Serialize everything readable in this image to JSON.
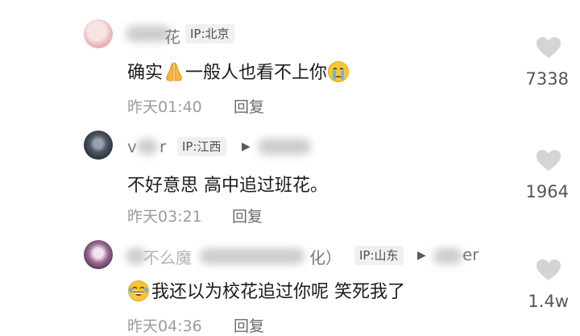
{
  "comments": [
    {
      "username_tail": "花",
      "ip": "IP:北京",
      "text_before": "确实",
      "text_middle": "一般人也看不上你",
      "time": "昨天01:40",
      "reply_label": "回复",
      "likes": "7338",
      "emojis": [
        "folded-hands",
        "crying-face"
      ]
    },
    {
      "username_head": "v",
      "username_tail": "r",
      "ip": "IP:江西",
      "reply_to_fragment": "",
      "text": "不好意思 高中追过班花。",
      "time": "昨天03:21",
      "reply_label": "回复",
      "likes": "1964"
    },
    {
      "username_head": "",
      "username_mid": "不么魔",
      "username_tail": "化）",
      "ip": "IP:山东",
      "reply_to_fragment": "er",
      "text": "我还以为校花追过你呢 笑死我了",
      "time": "昨天04:36",
      "reply_label": "回复",
      "likes": "1.4w",
      "emojis": [
        "laughing-tears-face"
      ]
    }
  ],
  "colors": {
    "heart": "#d4d4d4",
    "ip_tag_bg": "#f0f0f0",
    "meta_text": "#9b9b9b"
  }
}
